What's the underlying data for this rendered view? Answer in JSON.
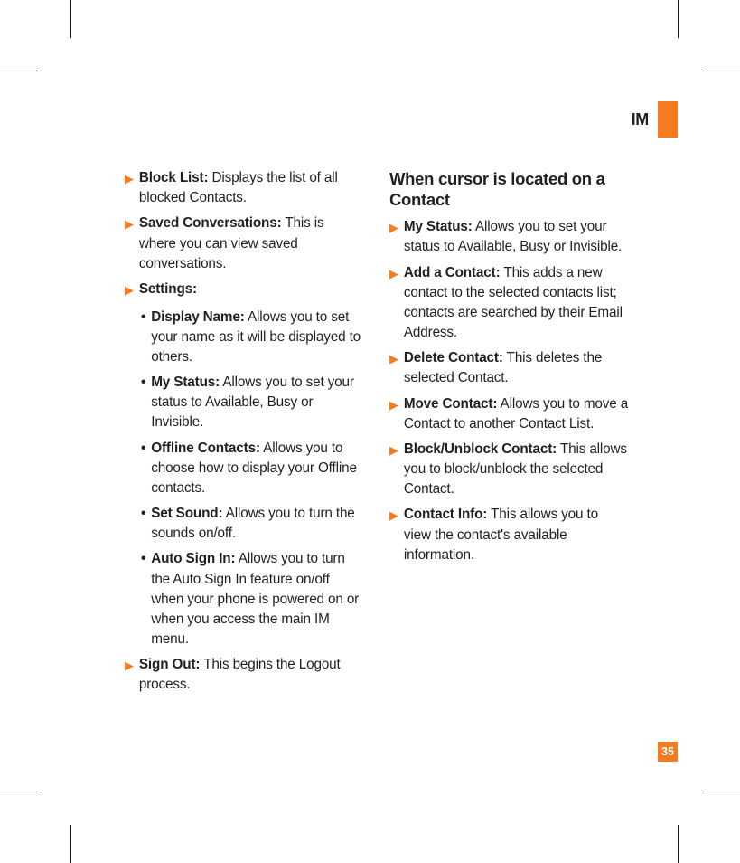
{
  "header": {
    "title": "IM"
  },
  "left_items": [
    {
      "label": "Block List:",
      "desc": " Displays the list of all blocked Contacts."
    },
    {
      "label": "Saved Conversations:",
      "desc": " This is where you can view saved conversations."
    },
    {
      "label": "Settings:",
      "desc": ""
    }
  ],
  "settings_sub": [
    {
      "label": "Display Name:",
      "desc": " Allows you to set your name as it will be displayed to others."
    },
    {
      "label": "My Status:",
      "desc": " Allows you to set your status to Available, Busy or Invisible."
    },
    {
      "label": "Offline Contacts:",
      "desc": " Allows you to choose how to display your Offline contacts."
    },
    {
      "label": "Set Sound:",
      "desc": " Allows you to turn the sounds on/off."
    },
    {
      "label": "Auto Sign In:",
      "desc": " Allows you to turn the Auto Sign In feature on/off when your phone is powered on or when you access the main IM menu."
    }
  ],
  "left_items2": [
    {
      "label": "Sign Out:",
      "desc": " This begins the Logout process."
    }
  ],
  "right_heading": "When cursor is located on a Contact",
  "right_items": [
    {
      "label": "My Status:",
      "desc": " Allows you to set your status to Available, Busy or Invisible."
    },
    {
      "label": "Add a Contact:",
      "desc": " This adds a new contact to the selected contacts list; contacts are searched by their Email Address."
    },
    {
      "label": "Delete Contact:",
      "desc": " This deletes the selected Contact."
    },
    {
      "label": "Move Contact:",
      "desc": " Allows you to move a Contact to another Contact List."
    },
    {
      "label": "Block/Unblock Contact:",
      "desc": " This allows you to block/unblock the selected Contact."
    },
    {
      "label": "Contact Info:",
      "desc": " This allows you to view the contact's available information."
    }
  ],
  "page_number": "35"
}
